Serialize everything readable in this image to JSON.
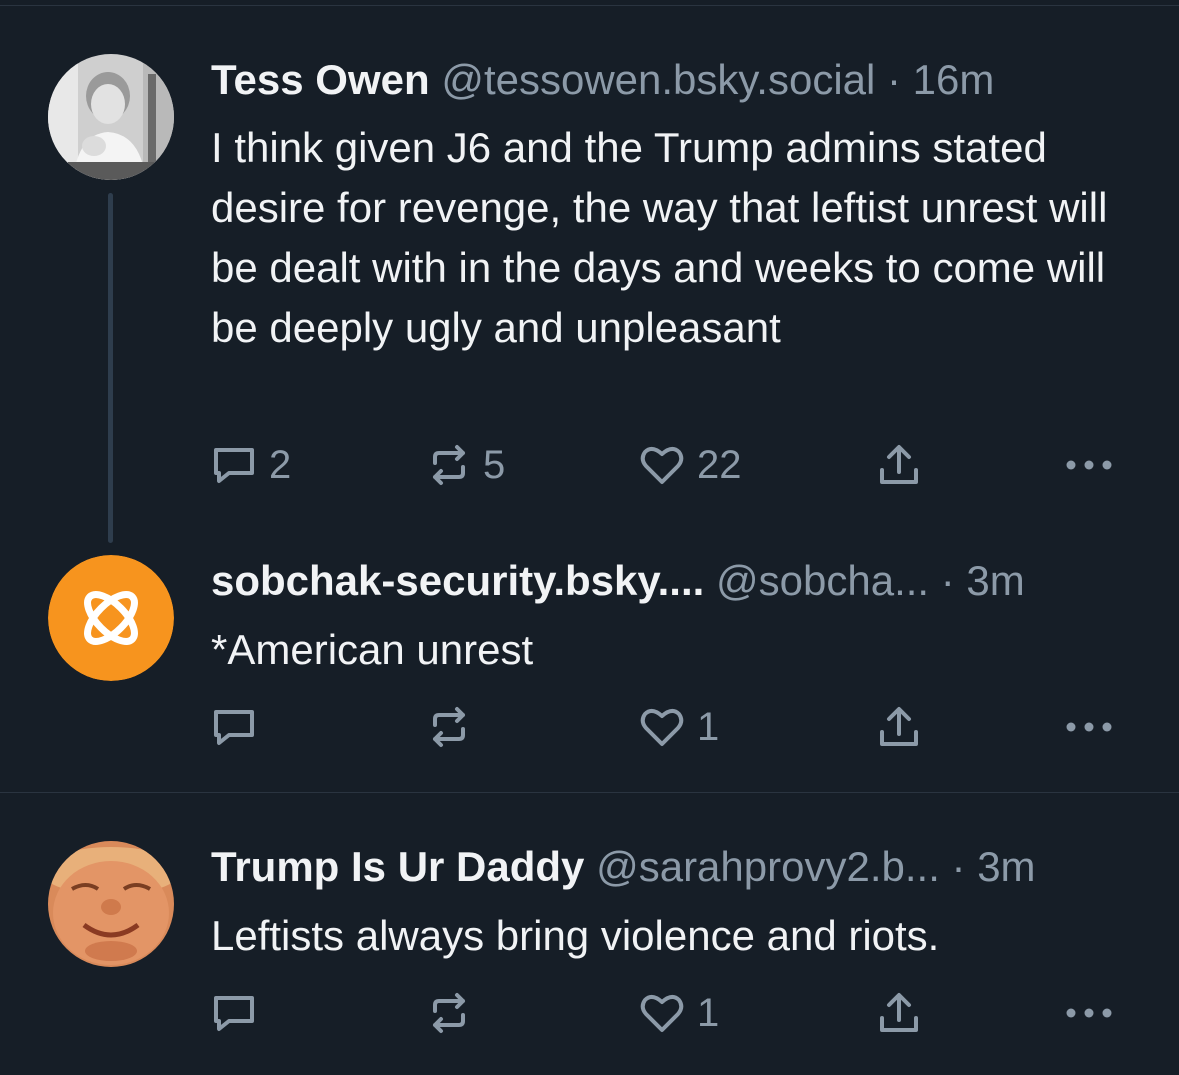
{
  "posts": [
    {
      "name": "Tess Owen",
      "handle": "@tessowen.bsky.social",
      "time": "· 16m",
      "text": "I think given J6 and the Trump admins stated desire for revenge, the way that leftist unrest will be dealt with in the days and weeks to come will be deeply ugly and unpleasant",
      "replies": "2",
      "reposts": "5",
      "likes": "22"
    },
    {
      "name": "sobchak-security.bsky....",
      "handle": "@sobcha...",
      "time": "· 3m",
      "text": "*American unrest",
      "replies": "",
      "reposts": "",
      "likes": "1"
    },
    {
      "name": "Trump Is Ur Daddy",
      "handle": "@sarahprovy2.b...",
      "time": "· 3m",
      "text": "Leftists always bring violence and riots.",
      "replies": "",
      "reposts": "",
      "likes": "1"
    }
  ],
  "colors": {
    "background": "#161e27",
    "text": "#f1f3f5",
    "muted": "#8c9aa8",
    "avatar_orange": "#f7941e"
  },
  "icons": [
    "reply-icon",
    "repost-icon",
    "like-icon",
    "share-icon",
    "more-icon"
  ]
}
